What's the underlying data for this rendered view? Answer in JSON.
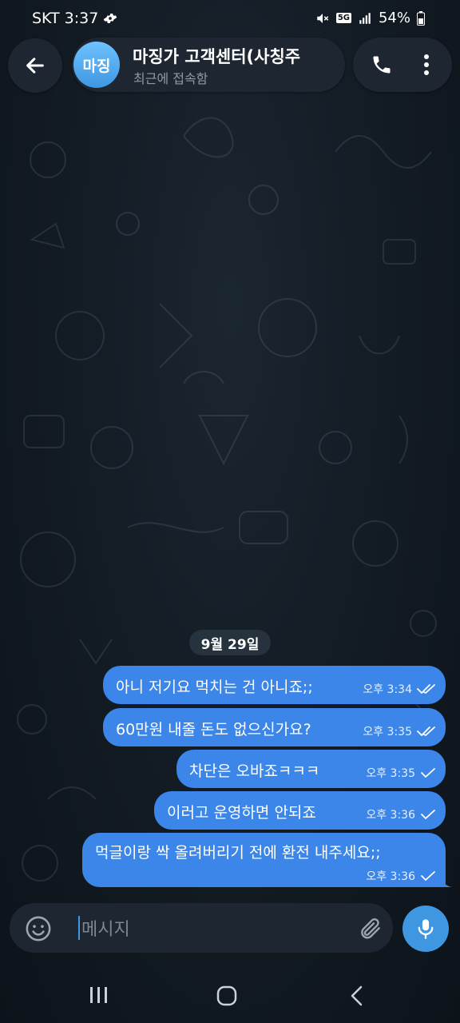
{
  "status": {
    "carrier": "SKT",
    "time": "3:37",
    "network": "5G",
    "battery": "54%"
  },
  "header": {
    "avatar_initials": "마징",
    "title": "마징가 고객센터(사칭주",
    "subtitle": "최근에 접속함",
    "accent": "#3f97e2"
  },
  "chat": {
    "date_label": "9월 29일",
    "messages": [
      {
        "text": "아니 저기요 먹치는 건 아니죠;;",
        "time": "오후 3:34",
        "status": "read"
      },
      {
        "text": "60만원 내줄 돈도 없으신가요?",
        "time": "오후 3:35",
        "status": "read"
      },
      {
        "text": "차단은 오바죠ㅋㅋㅋ",
        "time": "오후 3:35",
        "status": "sent"
      },
      {
        "text": "이러고 운영하면 안되죠",
        "time": "오후 3:36",
        "status": "sent"
      },
      {
        "text": "먹글이랑 싹 올려버리기 전에 환전 내주세요;;",
        "time": "오후 3:36",
        "status": "sent"
      }
    ],
    "bubble_color": "#3b86e8"
  },
  "composer": {
    "placeholder": "메시지"
  }
}
